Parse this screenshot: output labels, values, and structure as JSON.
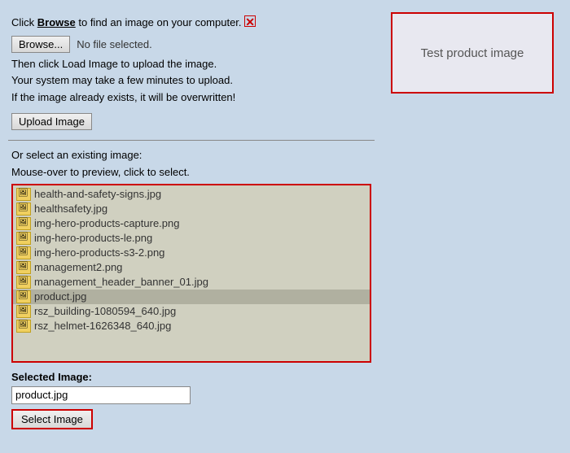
{
  "header": {
    "browse_instruction_pre": "Click ",
    "browse_link_text": "Browse",
    "browse_instruction_post": " to find an image on your computer.",
    "browse_button_label": "Browse...",
    "no_file_text": "No file selected.",
    "load_instruction": "Then click Load Image to upload the image.",
    "time_instruction": "Your system may take a few minutes to upload.",
    "overwrite_instruction": "If the image already exists, it will be overwritten!",
    "upload_button_label": "Upload Image"
  },
  "select_section": {
    "or_select_text": "Or select an existing image:",
    "mouseover_text": "Mouse-over to preview, click to select."
  },
  "file_list": {
    "items": [
      "health-and-safety-signs.jpg",
      "healthsafety.jpg",
      "img-hero-products-capture.png",
      "img-hero-products-le.png",
      "img-hero-products-s3-2.png",
      "management2.png",
      "management_header_banner_01.jpg",
      "product.jpg",
      "rsz_building-1080594_640.jpg",
      "rsz_helmet-1626348_640.jpg"
    ]
  },
  "selected_section": {
    "label": "Selected Image:",
    "input_value": "product.jpg",
    "button_label": "Select Image"
  },
  "preview": {
    "text": "Test product image"
  },
  "colors": {
    "border_red": "#cc0000",
    "bg_blue": "#c8d8e8"
  }
}
